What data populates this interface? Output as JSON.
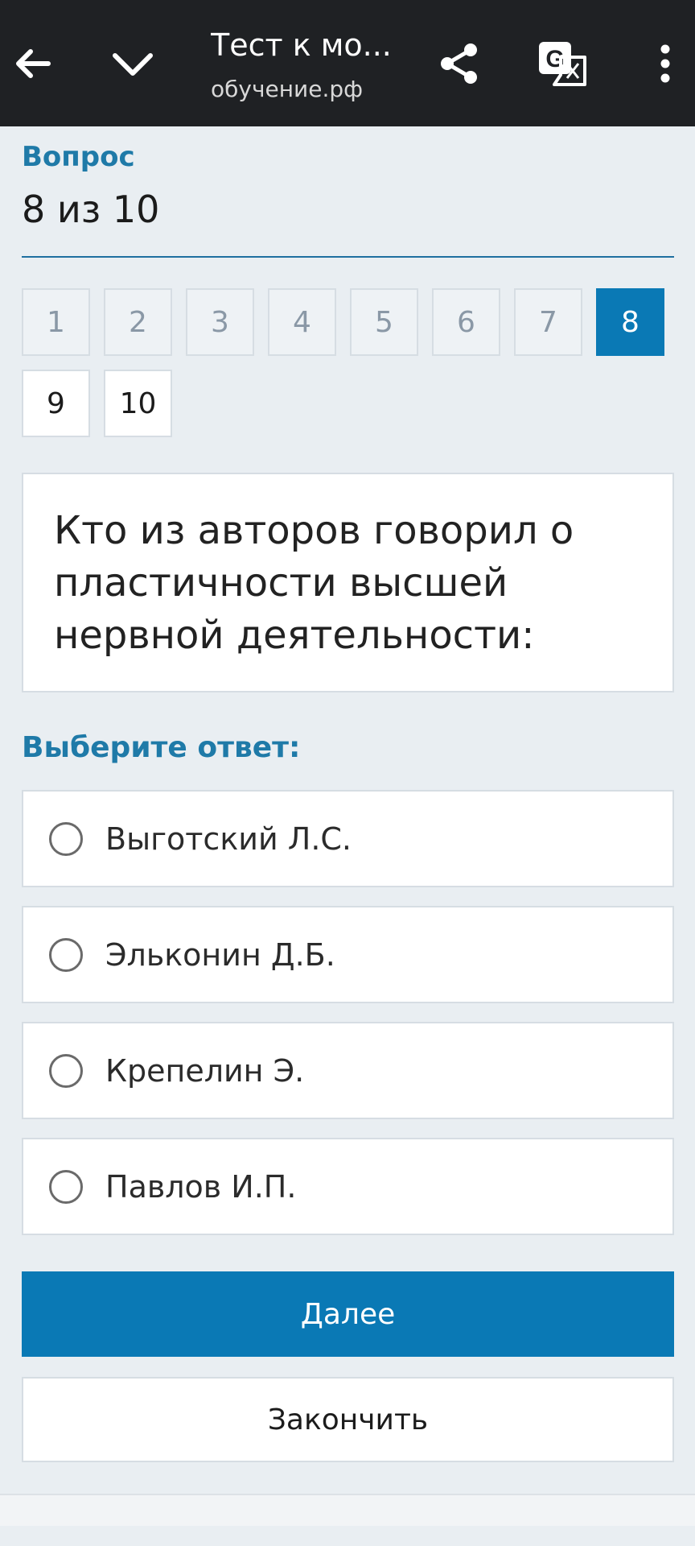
{
  "topbar": {
    "title": "Тест к мо...",
    "url": "обучение.рф",
    "icons": [
      "back-arrow-icon",
      "chevron-down-icon",
      "share-icon",
      "translate-icon",
      "more-vert-icon"
    ]
  },
  "question": {
    "label": "Вопрос",
    "count": "8 из 10",
    "nav": [
      "1",
      "2",
      "3",
      "4",
      "5",
      "6",
      "7",
      "8",
      "9",
      "10"
    ],
    "current": "8",
    "text": "Кто из авторов говорил о пластичности высшей нервной деятельности:"
  },
  "answers": {
    "label": "Выберите ответ:",
    "options": [
      "Выготский Л.С.",
      "Эльконин Д.Б.",
      "Крепелин Э.",
      "Павлов И.П."
    ]
  },
  "buttons": {
    "next": "Далее",
    "finish": "Закончить"
  },
  "colors": {
    "accent": "#0a79b5",
    "heading": "#1f7aa8",
    "topbar": "#1f2124",
    "background": "#e9eef2"
  }
}
